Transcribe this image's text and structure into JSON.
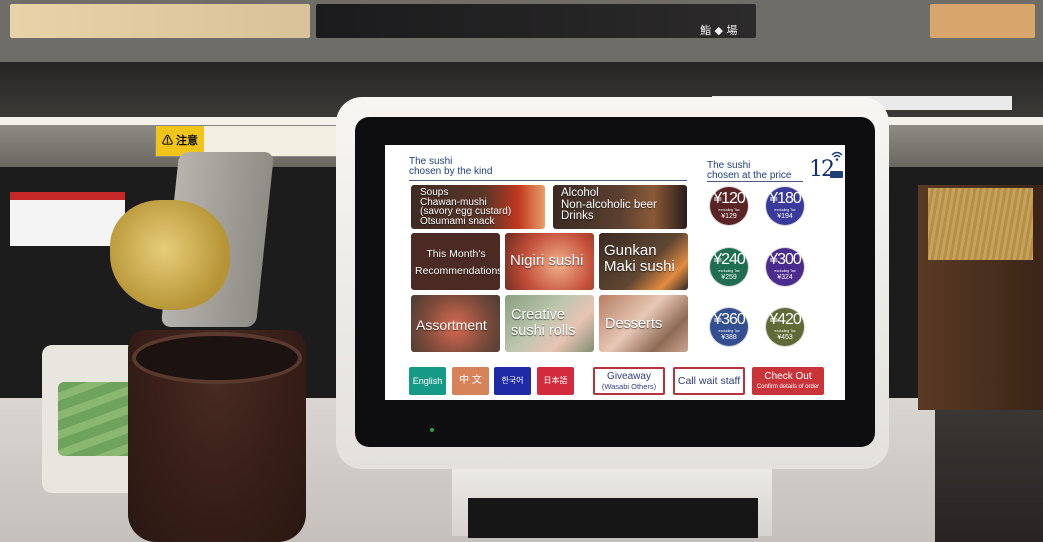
{
  "environment": {
    "brand": "鮨 ◆ 場",
    "warning_label": "⚠ 注意"
  },
  "header": {
    "left_line1": "The sushi",
    "left_line2": "chosen by the kind",
    "right_line1": "The sushi",
    "right_line2": "chosen at the price",
    "table_number": "12"
  },
  "categories": [
    {
      "lines": [
        "Soups",
        "Chawan-mushi",
        "(savory egg custard)",
        "Otsumami snack"
      ]
    },
    {
      "lines": [
        "Alcohol",
        "Non-alcoholic beer",
        "Drinks"
      ]
    },
    {
      "lines": [
        "This Month's",
        "Recommendations"
      ]
    },
    {
      "lines": [
        "Nigiri sushi"
      ]
    },
    {
      "lines": [
        "Gunkan",
        "Maki sushi"
      ]
    },
    {
      "lines": [
        "Assortment"
      ]
    },
    {
      "lines": [
        "Creative",
        "sushi rolls"
      ]
    },
    {
      "lines": [
        "Desserts"
      ]
    }
  ],
  "prices": [
    {
      "label": "¥120",
      "excl": "excluding Tax",
      "incl": "¥129",
      "incl_note": "including Tax",
      "color": "#5a2424"
    },
    {
      "label": "¥180",
      "excl": "excluding Tax",
      "incl": "¥194",
      "incl_note": "including Tax",
      "color": "#3a3a9c"
    },
    {
      "label": "¥240",
      "excl": "excluding Tax",
      "incl": "¥259",
      "incl_note": "including Tax",
      "color": "#1f6e52"
    },
    {
      "label": "¥300",
      "excl": "excluding Tax",
      "incl": "¥324",
      "incl_note": "including Tax",
      "color": "#4b2b8e"
    },
    {
      "label": "¥360",
      "excl": "excluding Tax",
      "incl": "¥388",
      "incl_note": "including Tax",
      "color": "#334f92"
    },
    {
      "label": "¥420",
      "excl": "excluding Tax",
      "incl": "¥453",
      "incl_note": "including Tax",
      "color": "#5f6a36"
    }
  ],
  "languages": [
    {
      "label": "English",
      "color": "#169a86"
    },
    {
      "label": "中 文",
      "color": "#d7835a"
    },
    {
      "label": "한국어",
      "color": "#1f2aa6"
    },
    {
      "label": "日本語",
      "color": "#d22b3e"
    }
  ],
  "actions": {
    "giveaway": "Giveaway",
    "giveaway_sub": "(Wasabi Others)",
    "call_staff": "Call wait staff",
    "checkout": "Check Out",
    "checkout_sub": "Confirm details of order"
  },
  "icons": [
    "wifi-icon",
    "battery-icon",
    "warning-icon"
  ]
}
